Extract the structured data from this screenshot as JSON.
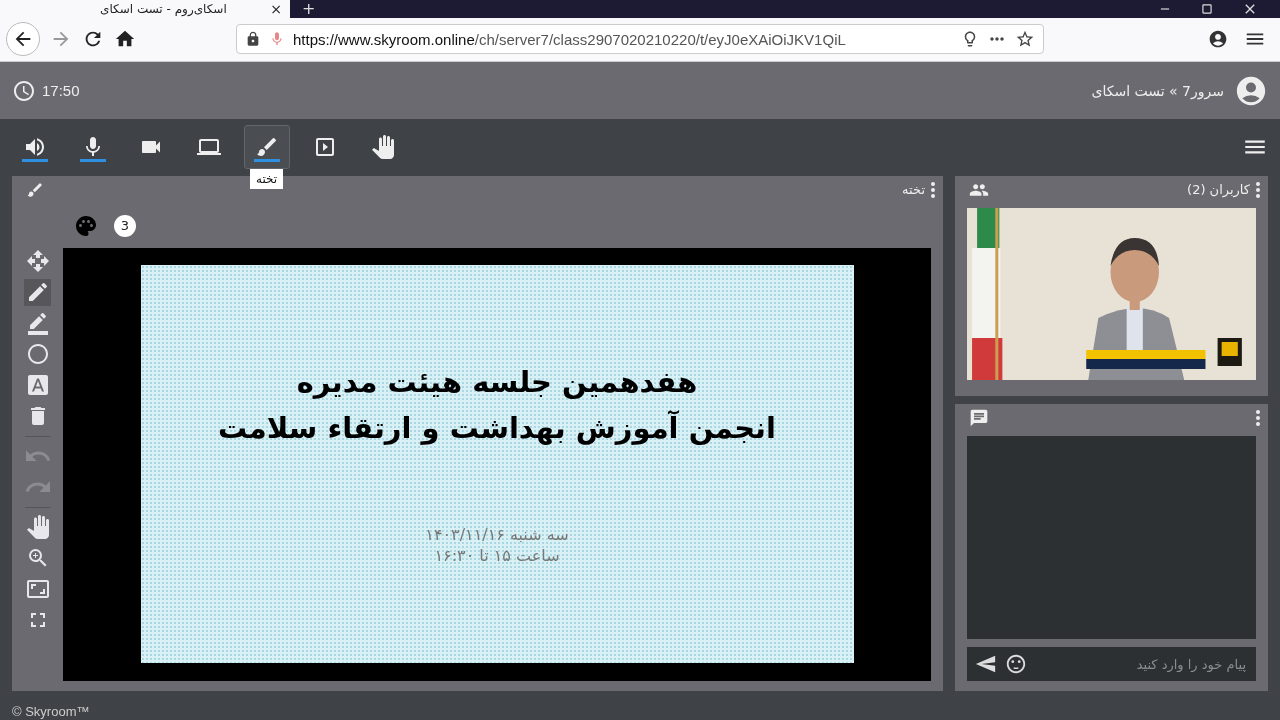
{
  "browser": {
    "tab_title": "اسکای‌روم - تست اسکای",
    "tab_close": "×",
    "new_tab": "+",
    "url_host": "https://www.skyroom.online",
    "url_path": "/ch/server7/class2907020210220/t/eyJ0eXAiOiJKV1QiL"
  },
  "header": {
    "clock": "17:50",
    "breadcrumb": "سرور7 » تست اسکای"
  },
  "toolbar": {
    "tooltip": "تخته",
    "buttons": [
      {
        "kind": "speaker",
        "on": true,
        "selected": false
      },
      {
        "kind": "mic",
        "on": true,
        "selected": false
      },
      {
        "kind": "camera",
        "on": false,
        "selected": false
      },
      {
        "kind": "screen",
        "on": false,
        "selected": false
      },
      {
        "kind": "board",
        "on": true,
        "selected": true
      },
      {
        "kind": "video",
        "on": false,
        "selected": false
      },
      {
        "kind": "hand",
        "on": false,
        "selected": false
      }
    ]
  },
  "board": {
    "title": "تخته",
    "brush_size": "3",
    "tools": [
      {
        "kind": "move",
        "selected": false,
        "disabled": false
      },
      {
        "kind": "pencil",
        "selected": true,
        "disabled": false
      },
      {
        "kind": "marker",
        "selected": false,
        "disabled": false
      },
      {
        "kind": "circle",
        "selected": false,
        "disabled": false
      },
      {
        "kind": "text",
        "selected": false,
        "disabled": false
      },
      {
        "kind": "delete",
        "selected": false,
        "disabled": false
      },
      {
        "kind": "undo",
        "selected": false,
        "disabled": true
      },
      {
        "kind": "redo",
        "selected": false,
        "disabled": true
      },
      {
        "kind": "pan",
        "selected": false,
        "disabled": false
      },
      {
        "kind": "zoom",
        "selected": false,
        "disabled": false
      },
      {
        "kind": "fit",
        "selected": false,
        "disabled": false
      },
      {
        "kind": "fullscreen",
        "selected": false,
        "disabled": false
      }
    ],
    "slide": {
      "title_lines": [
        "هفدهمین جلسه هیئت مدیره",
        "انجمن آموزش بهداشت و ارتقاء سلامت"
      ],
      "date_lines": [
        "سه شنبه ۱۴۰۳/۱۱/۱۶",
        "ساعت ۱۵ تا ۱۶:۳۰"
      ]
    }
  },
  "users": {
    "title": "کاربران (2)"
  },
  "chat": {
    "placeholder": "پیام خود را وارد کنید"
  },
  "footer": "© Skyroom™"
}
